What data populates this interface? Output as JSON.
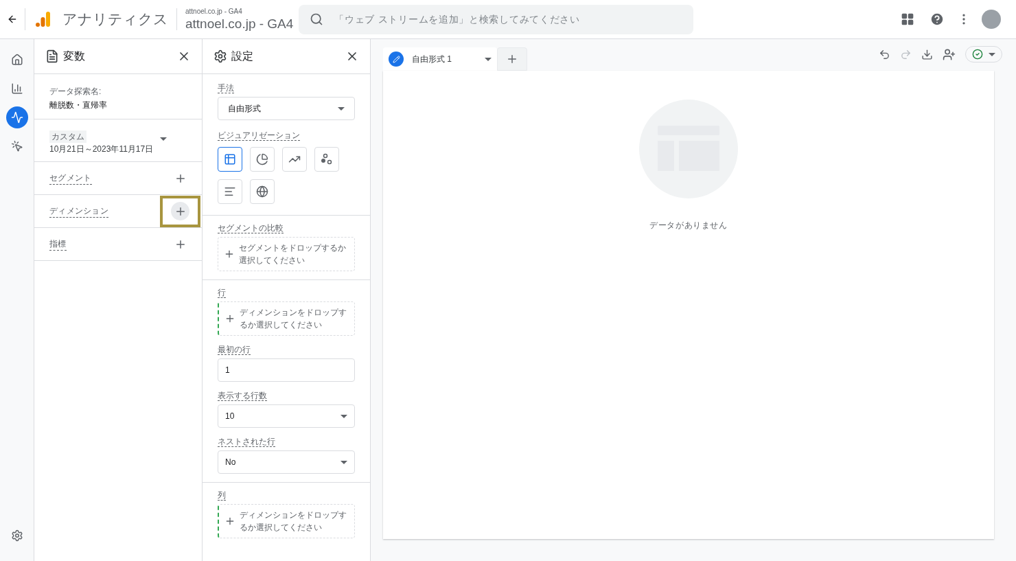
{
  "header": {
    "product": "アナリティクス",
    "account_path": "attnoel.co.jp - GA4",
    "property": "attnoel.co.jp - GA4",
    "search": {
      "placeholder": "「ウェブ ストリームを追加」と検索してみてください"
    }
  },
  "rail": [
    {
      "kind": "home",
      "selected": false
    },
    {
      "kind": "reports",
      "selected": false
    },
    {
      "kind": "explore",
      "selected": true
    },
    {
      "kind": "advertising",
      "selected": false
    }
  ],
  "variables": {
    "title": "変数",
    "name_label": "データ探索名:",
    "name": "離脱数・直帰率",
    "date_chip": "カスタム",
    "date_range": "10月21日～2023年11月17日",
    "sections": [
      {
        "label": "セグメント",
        "highlighted": false
      },
      {
        "label": "ディメンション",
        "highlighted": true
      },
      {
        "label": "指標",
        "highlighted": false
      }
    ]
  },
  "settings": {
    "title": "設定",
    "technique_label": "手法",
    "technique": "自由形式",
    "visualization_label": "ビジュアリゼーション",
    "visualizations": [
      {
        "kind": "table",
        "selected": true
      },
      {
        "kind": "donut",
        "selected": false
      },
      {
        "kind": "line",
        "selected": false
      },
      {
        "kind": "scatter",
        "selected": false
      },
      {
        "kind": "bar",
        "selected": false
      },
      {
        "kind": "geo",
        "selected": false
      }
    ],
    "segment_compare_label": "セグメントの比較",
    "segment_drop": "セグメントをドロップするか選択してください",
    "rows_label": "行",
    "rows_drop": "ディメンションをドロップするか選択してください",
    "first_row_label": "最初の行",
    "first_row": "1",
    "show_rows_label": "表示する行数",
    "show_rows": "10",
    "nested_rows_label": "ネストされた行",
    "nested_rows": "No",
    "columns_label": "列",
    "columns_drop": "ディメンションをドロップするか選択してください"
  },
  "canvas": {
    "tab": "自由形式 1",
    "empty_message": "データがありません"
  }
}
